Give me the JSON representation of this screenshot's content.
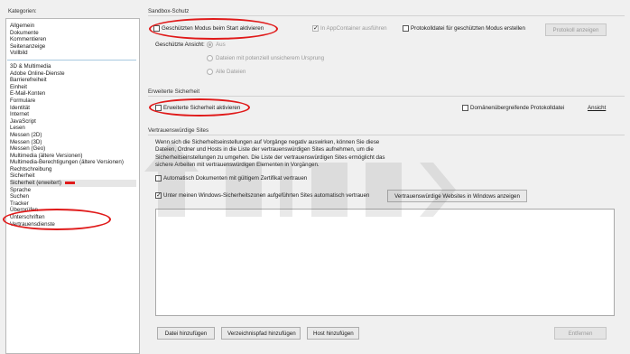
{
  "categories": {
    "title": "Kategorien:",
    "group1": [
      "Allgemein",
      "Dokumente",
      "Kommentieren",
      "Seitenanzeige",
      "Vollbild"
    ],
    "group2": [
      "3D & Multimedia",
      "Adobe Online-Dienste",
      "Barrierefreiheit",
      "Einheit",
      "E-Mail-Konten",
      "Formulare",
      "Identität",
      "Internet",
      "JavaScript",
      "Lesen",
      "Messen (2D)",
      "Messen (3D)",
      "Messen (Geo)",
      "Multimedia (ältere Versionen)",
      "Multimedia-Berechtigungen (ältere Versionen)",
      "Rechtschreibung",
      "Sicherheit"
    ],
    "selected": "Sicherheit (erweitert)",
    "group3": [
      "Sprache",
      "Suchen",
      "Tracker",
      "Überprüfen",
      "Unterschriften",
      "Vertrauensdienste"
    ]
  },
  "sandbox": {
    "title": "Sandbox-Schutz",
    "protected_mode_label": "Geschützten Modus beim Start aktivieren",
    "appcontainer_label": "In AppContainer ausführen",
    "logfile_label": "Protokolldatei für geschützten Modus erstellen",
    "show_log_button": "Protokoll anzeigen",
    "view_label": "Geschützte Ansicht:",
    "radio_off": "Aus",
    "radio_unsafe": "Dateien mit potenziell unsicherem Ursprung",
    "radio_all": "Alle Dateien"
  },
  "enhanced": {
    "title": "Erweiterte Sicherheit",
    "enable_label": "Erweiterte Sicherheit aktivieren",
    "cross_domain_label": "Domänenübergreifende Protokolldatei",
    "view_link": "Ansicht"
  },
  "trusted": {
    "title": "Vertrauenswürdige Sites",
    "description_lines": [
      "Wenn sich die Sicherheitseinstellungen auf Vorgänge negativ auswirken, können Sie diese",
      "Dateien, Ordner und Hosts in die Liste der vertrauenswürdigen Sites aufnehmen, um die",
      "Sicherheitseinstellungen zu umgehen. Die Liste der vertrauenswürdigen Sites ermöglicht das",
      "sichere Arbeiten mit vertrauenswürdigen Elementen in Vorgängen."
    ],
    "auto_cert_label": "Automatisch Dokumenten mit gültigem Zertifikat vertrauen",
    "windows_zone_label": "Unter meinen Windows-Sicherheitszonen aufgeführten Sites automatisch vertrauen",
    "show_windows_button": "Vertrauenswürdige Websites in Windows anzeigen",
    "add_file_button": "Datei hinzufügen",
    "add_folder_button": "Verzeichnispfad hinzufügen",
    "add_host_button": "Host hinzufügen",
    "remove_button": "Entfernen"
  },
  "colors": {
    "annotation": "#e01a1a",
    "background": "#f0f0f0"
  }
}
